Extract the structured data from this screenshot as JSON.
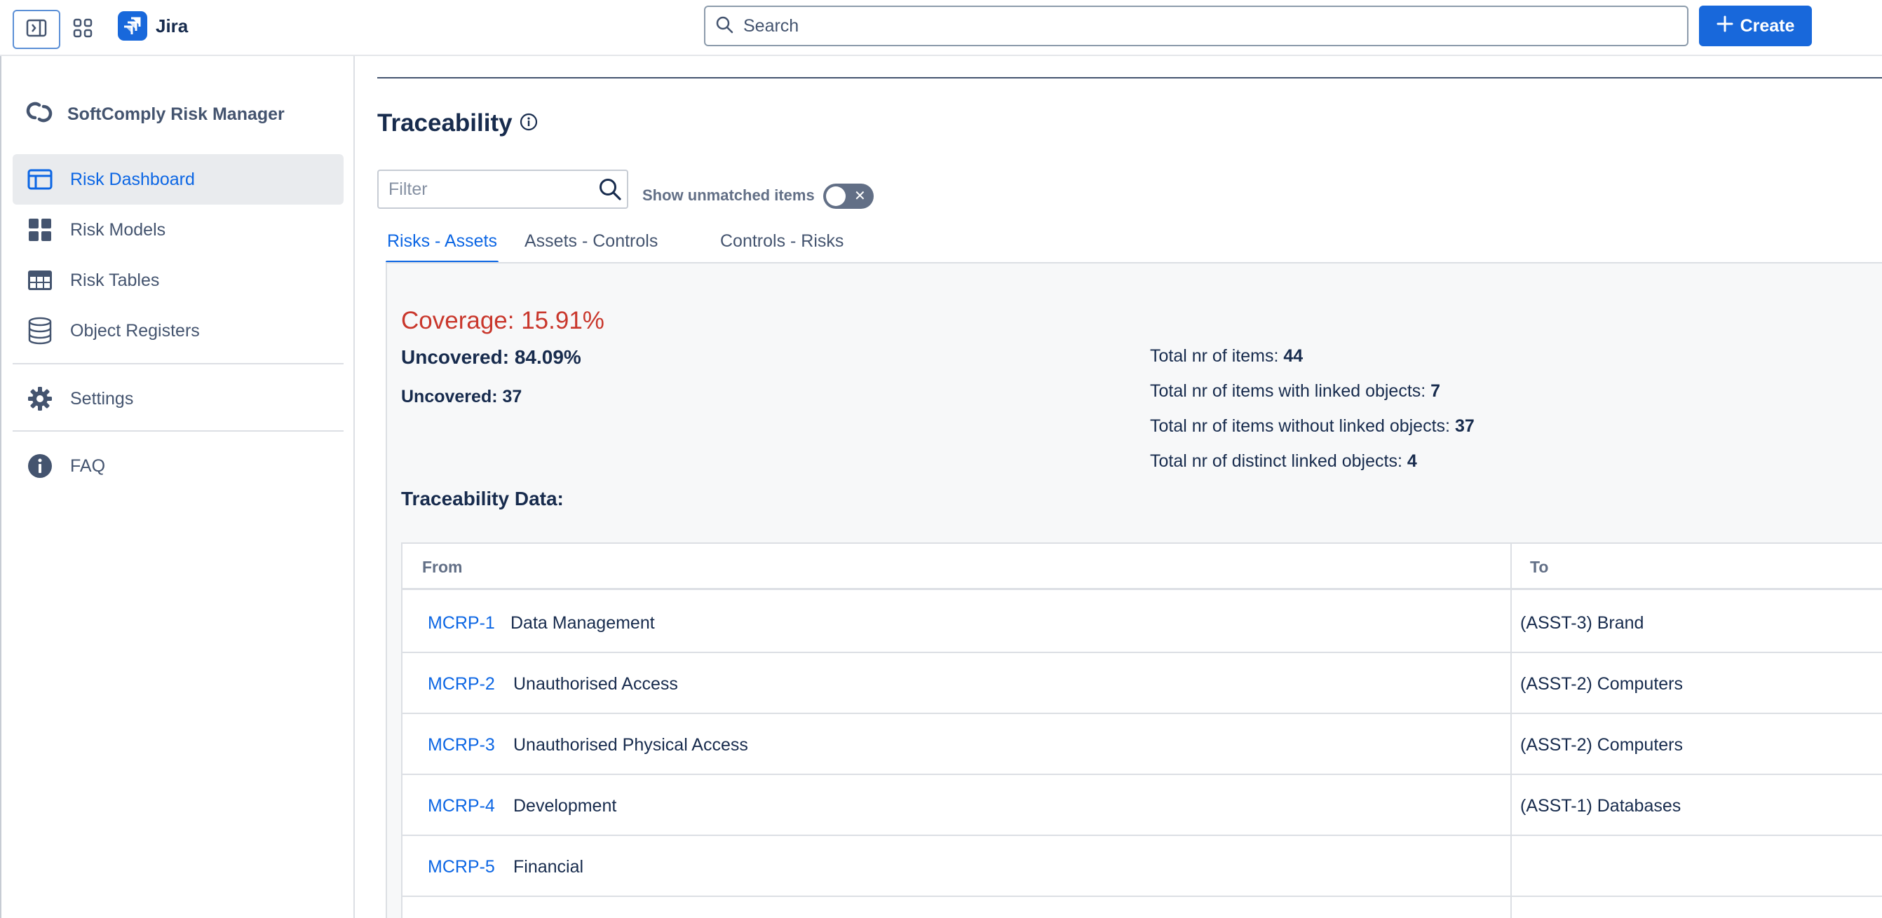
{
  "topbar": {
    "app_name": "Jira",
    "search_placeholder": "Search",
    "create_label": "Create"
  },
  "sidebar": {
    "app_title": "SoftComply Risk Manager",
    "items": [
      {
        "label": "Risk Dashboard",
        "icon": "dashboard-icon",
        "active": true
      },
      {
        "label": "Risk Models",
        "icon": "grid-icon"
      },
      {
        "label": "Risk Tables",
        "icon": "table-icon"
      },
      {
        "label": "Object Registers",
        "icon": "database-icon"
      },
      {
        "label": "Settings",
        "icon": "gear-icon"
      },
      {
        "label": "FAQ",
        "icon": "info-icon"
      }
    ]
  },
  "main": {
    "title": "Traceability",
    "filter_placeholder": "Filter",
    "show_unmatched_label": "Show unmatched items",
    "show_unmatched_enabled": false,
    "tabs": [
      {
        "label": "Risks - Assets",
        "active": true
      },
      {
        "label": "Assets - Controls"
      },
      {
        "label": "Controls - Risks"
      }
    ],
    "coverage": "Coverage: 15.91%",
    "uncovered_pct": "Uncovered: 84.09%",
    "uncovered_count": "Uncovered: 37",
    "stats": [
      {
        "label": "Total nr of items: ",
        "value": "44"
      },
      {
        "label": "Total nr of items with linked objects: ",
        "value": "7"
      },
      {
        "label": "Total nr of items without linked objects: ",
        "value": "37"
      },
      {
        "label": "Total nr of distinct linked objects: ",
        "value": "4"
      }
    ],
    "trace_title": "Traceability Data:",
    "table": {
      "headers": {
        "from": "From",
        "to": "To"
      },
      "rows": [
        {
          "key": "MCRP-1",
          "summary": "Data Management",
          "to": "(ASST-3) Brand"
        },
        {
          "key": "MCRP-2",
          "summary": "Unauthorised Access",
          "to": "(ASST-2) Computers"
        },
        {
          "key": "MCRP-3",
          "summary": "Unauthorised Physical Access",
          "to": "(ASST-2) Computers"
        },
        {
          "key": "MCRP-4",
          "summary": "Development",
          "to": "(ASST-1) Databases"
        },
        {
          "key": "MCRP-5",
          "summary": "Financial",
          "to": ""
        }
      ]
    }
  },
  "colors": {
    "accent": "#0c66e4",
    "brand": "#1868db",
    "coverage_red": "#c9372c"
  }
}
